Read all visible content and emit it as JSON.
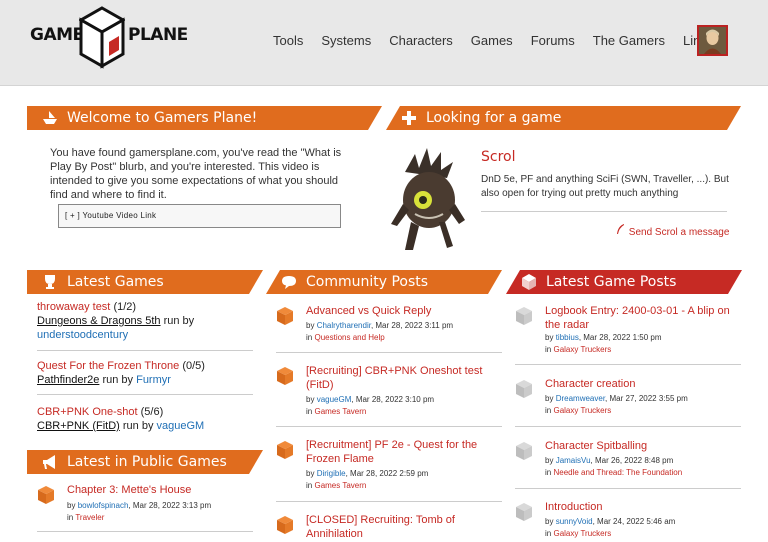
{
  "header": {
    "logo_left": "GAMERS",
    "logo_right": "PLANE",
    "nav": [
      "Tools",
      "Systems",
      "Characters",
      "Games",
      "Forums",
      "The Gamers",
      "Links"
    ]
  },
  "welcome": {
    "title": "Welcome to Gamers Plane!",
    "text": "You have found gamersplane.com, you've read the \"What is Play By Post\" blurb, and you're interested. This video is intended to give you some expectations of what you should find and where to find it.",
    "video_link": "[ + ] Youtube Video Link"
  },
  "lfg": {
    "title": "Looking for a game",
    "name": "Scrol",
    "desc": "DnD 5e, PF and anything SciFi (SWN, Traveller, ...). But also open for trying out pretty much anything",
    "message": "Send Scrol a message"
  },
  "latest_games": {
    "title": "Latest Games",
    "items": [
      {
        "title": "throwaway test",
        "count": "(1/2)",
        "system": "Dungeons & Dragons 5th",
        "run_by": "run by",
        "gm": "understoodcentury"
      },
      {
        "title": "Quest For the Frozen Throne",
        "count": "(0/5)",
        "system": "Pathfinder2e",
        "run_by": "run by",
        "gm": "Furmyr"
      },
      {
        "title": "CBR+PNK One-shot",
        "count": "(5/6)",
        "system": "CBR+PNK (FitD)",
        "run_by": "run by",
        "gm": "vagueGM"
      }
    ]
  },
  "public_games": {
    "title": "Latest in Public Games",
    "items": [
      {
        "title": "Chapter 3: Mette's House",
        "by": "by",
        "user": "bowlofspinach",
        "date": ", Mar 28, 2022 3:13 pm",
        "in": "in",
        "forum": "Traveler"
      }
    ]
  },
  "community": {
    "title": "Community Posts",
    "items": [
      {
        "title": "Advanced vs Quick Reply",
        "by": "by",
        "user": "Chalrytharendir",
        "date": ", Mar 28, 2022 3:11 pm",
        "in": "in",
        "forum": "Questions and Help"
      },
      {
        "title": "[Recruiting] CBR+PNK Oneshot test (FitD)",
        "by": "by",
        "user": "vagueGM",
        "date": ", Mar 28, 2022 3:10 pm",
        "in": "in",
        "forum": "Games Tavern"
      },
      {
        "title": "[Recruitment] PF 2e - Quest for the Frozen Flame",
        "by": "by",
        "user": "Dirigible",
        "date": ", Mar 28, 2022 2:59 pm",
        "in": "in",
        "forum": "Games Tavern"
      },
      {
        "title": "[CLOSED] Recruiting: Tomb of Annihilation",
        "by": "",
        "user": "",
        "date": "",
        "in": "",
        "forum": ""
      }
    ]
  },
  "game_posts": {
    "title": "Latest Game Posts",
    "items": [
      {
        "title": "Logbook Entry: 2400-03-01 - A blip on the radar",
        "by": "by",
        "user": "tibbius",
        "date": ", Mar 28, 2022 1:50 pm",
        "in": "in",
        "forum": "Galaxy Truckers"
      },
      {
        "title": "Character creation",
        "by": "by",
        "user": "Dreamweaver",
        "date": ", Mar 27, 2022 3:55 pm",
        "in": "in",
        "forum": "Galaxy Truckers"
      },
      {
        "title": "Character Spitballing",
        "by": "by",
        "user": "JamaisVu",
        "date": ", Mar 26, 2022 8:48 pm",
        "in": "in",
        "forum": "Needle and Thread: The Foundation"
      },
      {
        "title": "Introduction",
        "by": "by",
        "user": "sunnyVoid",
        "date": ", Mar 24, 2022 5:46 am",
        "in": "in",
        "forum": "Galaxy Truckers"
      }
    ]
  },
  "colors": {
    "orange": "#e06c1e",
    "red": "#c62a24",
    "blue": "#1f6fb5"
  }
}
